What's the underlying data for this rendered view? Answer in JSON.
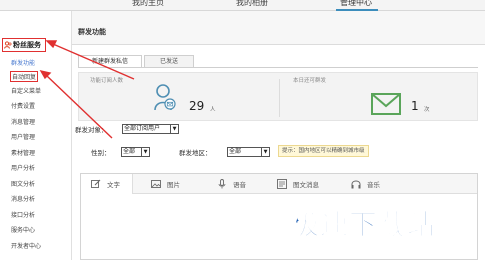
{
  "topnav": {
    "items": [
      "我的主页",
      "我的相册",
      "管理中心"
    ],
    "active_index": 2
  },
  "sidebar": {
    "section_title": "粉丝服务",
    "items": [
      "群发功能",
      "自动回复",
      "自定义菜单",
      "付费设置",
      "消息管理",
      "用户管理",
      "素材管理",
      "用户分析",
      "图文分析",
      "消息分析",
      "接口分析",
      "服务中心",
      "开发者中心"
    ]
  },
  "main": {
    "title": "群发功能",
    "tabs": [
      "新建群发私信",
      "已发送"
    ],
    "active_tab": 0,
    "stats": {
      "subscribers_label": "功能订阅人数",
      "subscribers_value": "29",
      "subscribers_unit": "人",
      "remaining_label": "本日还可群发",
      "remaining_value": "1",
      "remaining_unit": "次"
    },
    "filters": {
      "target_label": "群发对象：",
      "target_value": "全部订阅用户",
      "gender_label": "性别：",
      "gender_value": "全部",
      "region_label": "群发地区：",
      "region_value": "全部",
      "hint": "提示：国内地区可以精确到城市级"
    },
    "editor_tabs": [
      {
        "label": "文字",
        "icon": "pencil-icon"
      },
      {
        "label": "图片",
        "icon": "picture-icon"
      },
      {
        "label": "语音",
        "icon": "microphone-icon"
      },
      {
        "label": "图文消息",
        "icon": "article-icon"
      },
      {
        "label": "音乐",
        "icon": "headphones-icon"
      }
    ],
    "active_editor_tab": 0
  },
  "watermark": "极速下载站",
  "colors": {
    "highlight_red": "#e03030",
    "accent_blue": "#3c8dbc",
    "link_blue": "#4a7bd0",
    "user_icon_blue": "#4f8fb3",
    "mail_icon_green": "#5aa55a",
    "hint_bg": "#fff8d8"
  }
}
